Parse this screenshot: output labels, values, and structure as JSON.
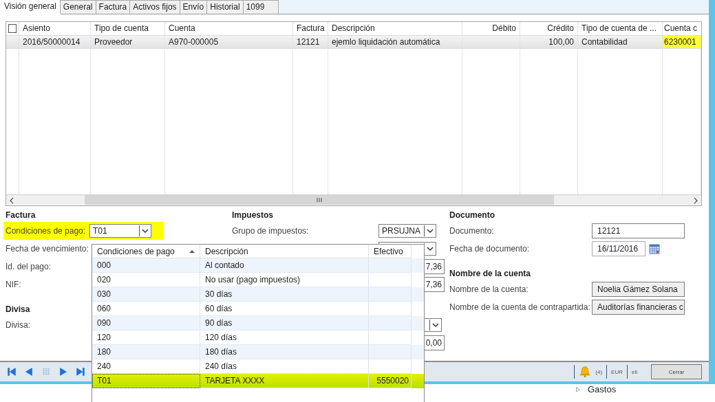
{
  "tabs": [
    {
      "label": "Visión general",
      "selected": true
    },
    {
      "label": "General",
      "selected": false
    },
    {
      "label": "Factura",
      "selected": false
    },
    {
      "label": "Activos fijos",
      "selected": false
    },
    {
      "label": "Envío",
      "selected": false
    },
    {
      "label": "Historial",
      "selected": false
    },
    {
      "label": "1099",
      "selected": false
    }
  ],
  "grid": {
    "select_all": {
      "checked": false
    },
    "columns": [
      "Asiento",
      "Tipo de cuenta",
      "Cuenta",
      "Factura",
      "Descripción",
      "Débito",
      "Crédito",
      "Tipo de cuenta de ...",
      "Cuenta c"
    ],
    "rows": [
      {
        "selected": true,
        "cells": [
          {
            "text": "2016/50000014",
            "highlighted": false
          },
          {
            "text": "Proveedor",
            "highlighted": false
          },
          {
            "text": "A970-000005",
            "highlighted": false
          },
          {
            "text": "12121",
            "highlighted": false
          },
          {
            "text": "ejemlo liquidación automática",
            "highlighted": false
          },
          null,
          {
            "text": "100,00",
            "highlighted": false
          },
          {
            "text": "Contabilidad",
            "highlighted": false
          },
          {
            "text": "6230001",
            "highlighted": true
          }
        ]
      }
    ]
  },
  "sections": [
    [
      {
        "title": "Factura",
        "fields": [
          {
            "label": "Condiciones de pago:",
            "kind": "combo",
            "value": "T01",
            "highlighted": true
          },
          {
            "label": "Fecha de vencimiento:",
            "kind": "hidden",
            "highlighted": false
          },
          {
            "label": "Id. del pago:",
            "kind": "hidden",
            "highlighted": false
          },
          {
            "label": "NIF:",
            "kind": "hidden",
            "highlighted": false
          }
        ]
      },
      {
        "title": "Divisa",
        "fields": [
          {
            "label": "Divisa:",
            "kind": "hidden",
            "highlighted": false
          }
        ]
      }
    ],
    [
      {
        "title": "Impuestos",
        "fields": [
          {
            "label": "Grupo de impuestos:",
            "kind": "combo",
            "value": "PRSUJNA",
            "highlighted": false
          },
          {
            "kind": "combo",
            "highlighted": false
          },
          {
            "kind": "amount",
            "value": "7,36",
            "highlighted": false
          },
          {
            "kind": "amount",
            "value": "7,36",
            "highlighted": false
          }
        ]
      },
      {
        "fields": [
          {
            "kind": "wide_combo",
            "highlighted": false
          },
          {
            "kind": "amount",
            "value": "0,00",
            "highlighted": false
          }
        ]
      }
    ],
    [
      {
        "title": "Documento",
        "fields": [
          {
            "label": "Documento:",
            "kind": "text",
            "value": "12121",
            "highlighted": false
          },
          {
            "label": "Fecha de documento:",
            "kind": "date",
            "value": "16/11/2016",
            "highlighted": false
          }
        ]
      },
      {
        "title": "Nombre de la cuenta",
        "fields": [
          {
            "label": "Nombre de la cuenta:",
            "kind": "readonly",
            "value": "Noelia Gámez Solana",
            "highlighted": false
          },
          {
            "label": "Nombre de la cuenta de contrapartida:",
            "kind": "readonly",
            "value": "Auditorías financieras c",
            "highlighted": false
          }
        ]
      }
    ]
  ],
  "lookup": {
    "columns": [
      {
        "label": "Condiciones de pago",
        "sorted": true
      },
      {
        "label": "Descripción",
        "sorted": false
      },
      {
        "label": "Efectivo",
        "sorted": false
      }
    ],
    "rows": [
      {
        "code": "000",
        "description": "Al contado",
        "selected": false,
        "highlighted": false
      },
      {
        "code": "020",
        "description": "No usar (pago impuestos)",
        "selected": false,
        "highlighted": false
      },
      {
        "code": "030",
        "description": "30 días",
        "selected": false,
        "highlighted": false
      },
      {
        "code": "060",
        "description": "60 días",
        "selected": false,
        "highlighted": false
      },
      {
        "code": "090",
        "description": "90 días",
        "selected": false,
        "highlighted": false
      },
      {
        "code": "120",
        "description": "120 días",
        "selected": false,
        "highlighted": false
      },
      {
        "code": "180",
        "description": "180 días",
        "selected": false,
        "highlighted": false
      },
      {
        "code": "240",
        "description": "240 días",
        "selected": false,
        "highlighted": false
      },
      {
        "code": "T01",
        "description": "TARJETA XXXX",
        "cash": "5550020",
        "selected": true,
        "highlighted": true
      }
    ]
  },
  "status_bar": {
    "nav": [
      {
        "kind": "first",
        "disabled": false
      },
      {
        "kind": "prev",
        "disabled": false
      },
      {
        "kind": "grid",
        "disabled": true
      },
      {
        "kind": "next",
        "disabled": false
      },
      {
        "kind": "last",
        "disabled": false
      }
    ],
    "notifications": "(4)",
    "currency": "EUR",
    "company": "eli",
    "close_button": "Cerrar"
  },
  "background_tree": [
    {
      "label": "Gastos"
    }
  ]
}
